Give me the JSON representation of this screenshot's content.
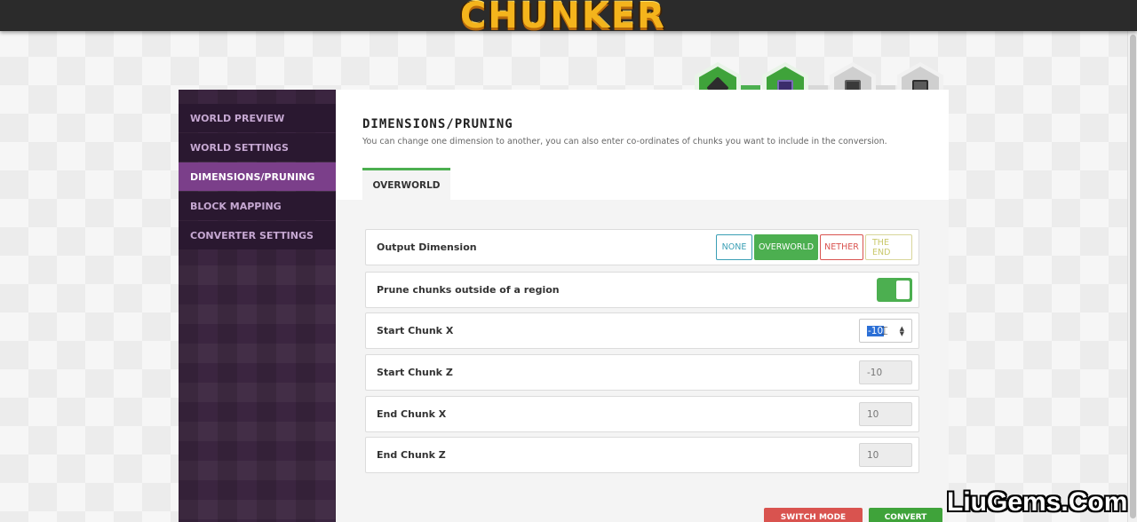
{
  "app": {
    "logo_text": "CHUNKER"
  },
  "sidebar": {
    "items": [
      {
        "label": "WORLD PREVIEW"
      },
      {
        "label": "WORLD SETTINGS"
      },
      {
        "label": "DIMENSIONS/PRUNING",
        "active": true
      },
      {
        "label": "BLOCK MAPPING"
      },
      {
        "label": "CONVERTER SETTINGS"
      }
    ]
  },
  "main": {
    "title": "DIMENSIONS/PRUNING",
    "description": "You can change one dimension to another, you can also enter co-ordinates of chunks you want to include in the conversion.",
    "tabs": [
      {
        "label": "OVERWORLD",
        "active": true
      }
    ]
  },
  "settings": {
    "output_dimension": {
      "label": "Output Dimension",
      "options": [
        "NONE",
        "OVERWORLD",
        "NETHER",
        "THE END"
      ],
      "selected": "OVERWORLD"
    },
    "prune": {
      "label": "Prune chunks outside of a region",
      "enabled": true
    },
    "start_x": {
      "label": "Start Chunk X",
      "value": "-10"
    },
    "start_z": {
      "label": "Start Chunk Z",
      "value": "-10"
    },
    "end_x": {
      "label": "End Chunk X",
      "value": "10"
    },
    "end_z": {
      "label": "End Chunk Z",
      "value": "10"
    }
  },
  "progress": {
    "steps": [
      {
        "icon": "anvil-icon",
        "state": "complete"
      },
      {
        "icon": "portal-block-icon",
        "state": "complete"
      },
      {
        "icon": "furnace-icon",
        "state": "pending"
      },
      {
        "icon": "dispenser-icon",
        "state": "pending"
      }
    ]
  },
  "footer": {
    "switch_label": "SWITCH MODE",
    "convert_label": "CONVERT"
  },
  "watermark": "LiuGems.Com",
  "colors": {
    "accent_green": "#4caf50",
    "sidebar_active": "#7b3f8a",
    "none_color": "#3a9fb5",
    "nether_color": "#d9534f",
    "end_color": "#c9c86a"
  }
}
